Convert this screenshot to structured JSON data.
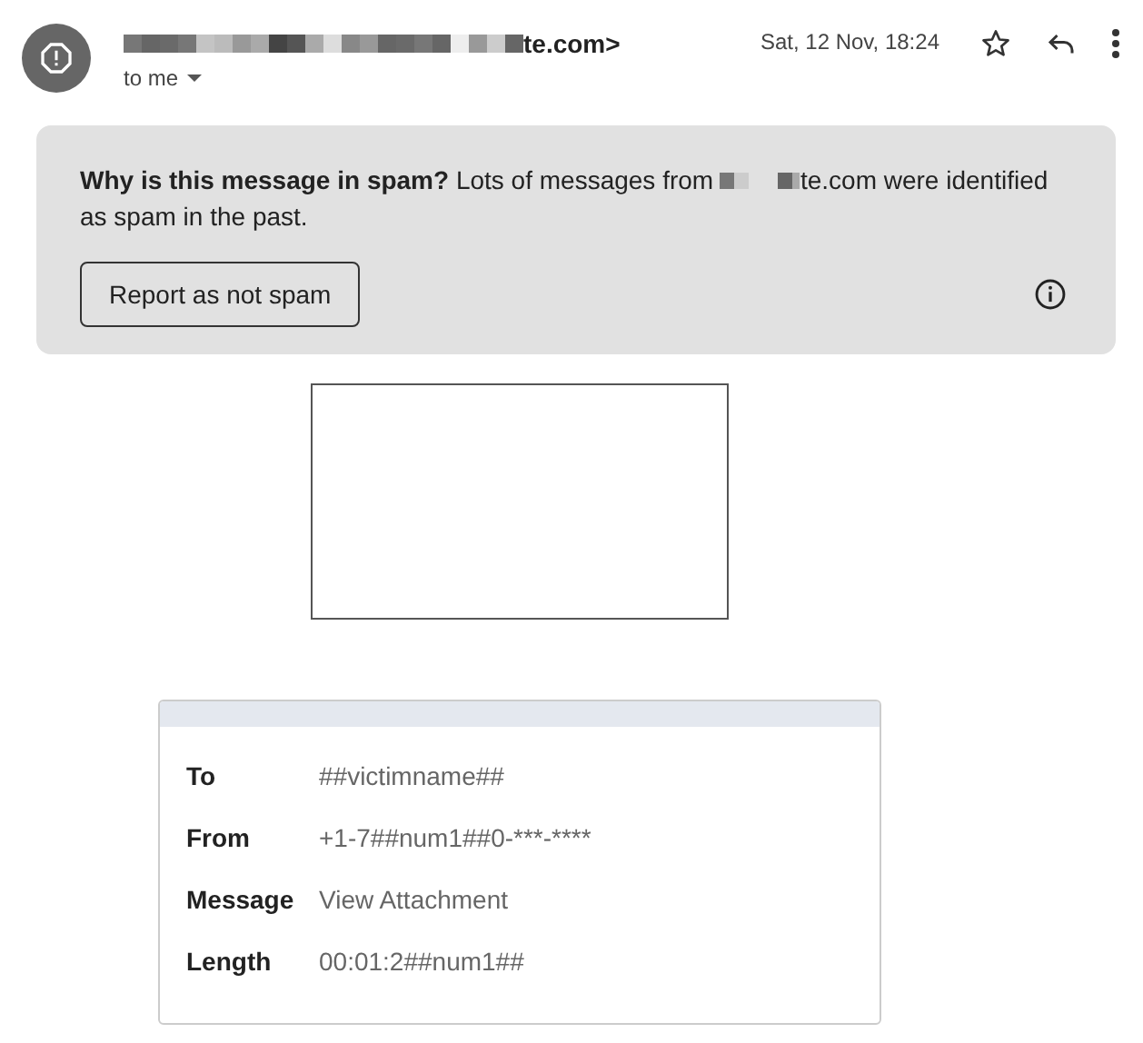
{
  "header": {
    "sender_visible": "te.com>",
    "sender_redacted": true,
    "recipient": "to me",
    "date": "Sat, 12 Nov, 18:24"
  },
  "spam_notice": {
    "text": "**Why is this message in spam?** Lots of messages from ",
    "domain_redacted": true,
    "text_after": "te.com were identified as spam in the past.",
    "button": "Report as not spam"
  },
  "message": {
    "fields": [
      {
        "label": "To",
        "value": "##victimname##"
      },
      {
        "label": "From",
        "value": "+1-7##num1##0-***-****"
      },
      {
        "label": "Message",
        "value": "View Attachment"
      },
      {
        "label": "Length",
        "value": "00:01:2##num1##"
      }
    ]
  }
}
